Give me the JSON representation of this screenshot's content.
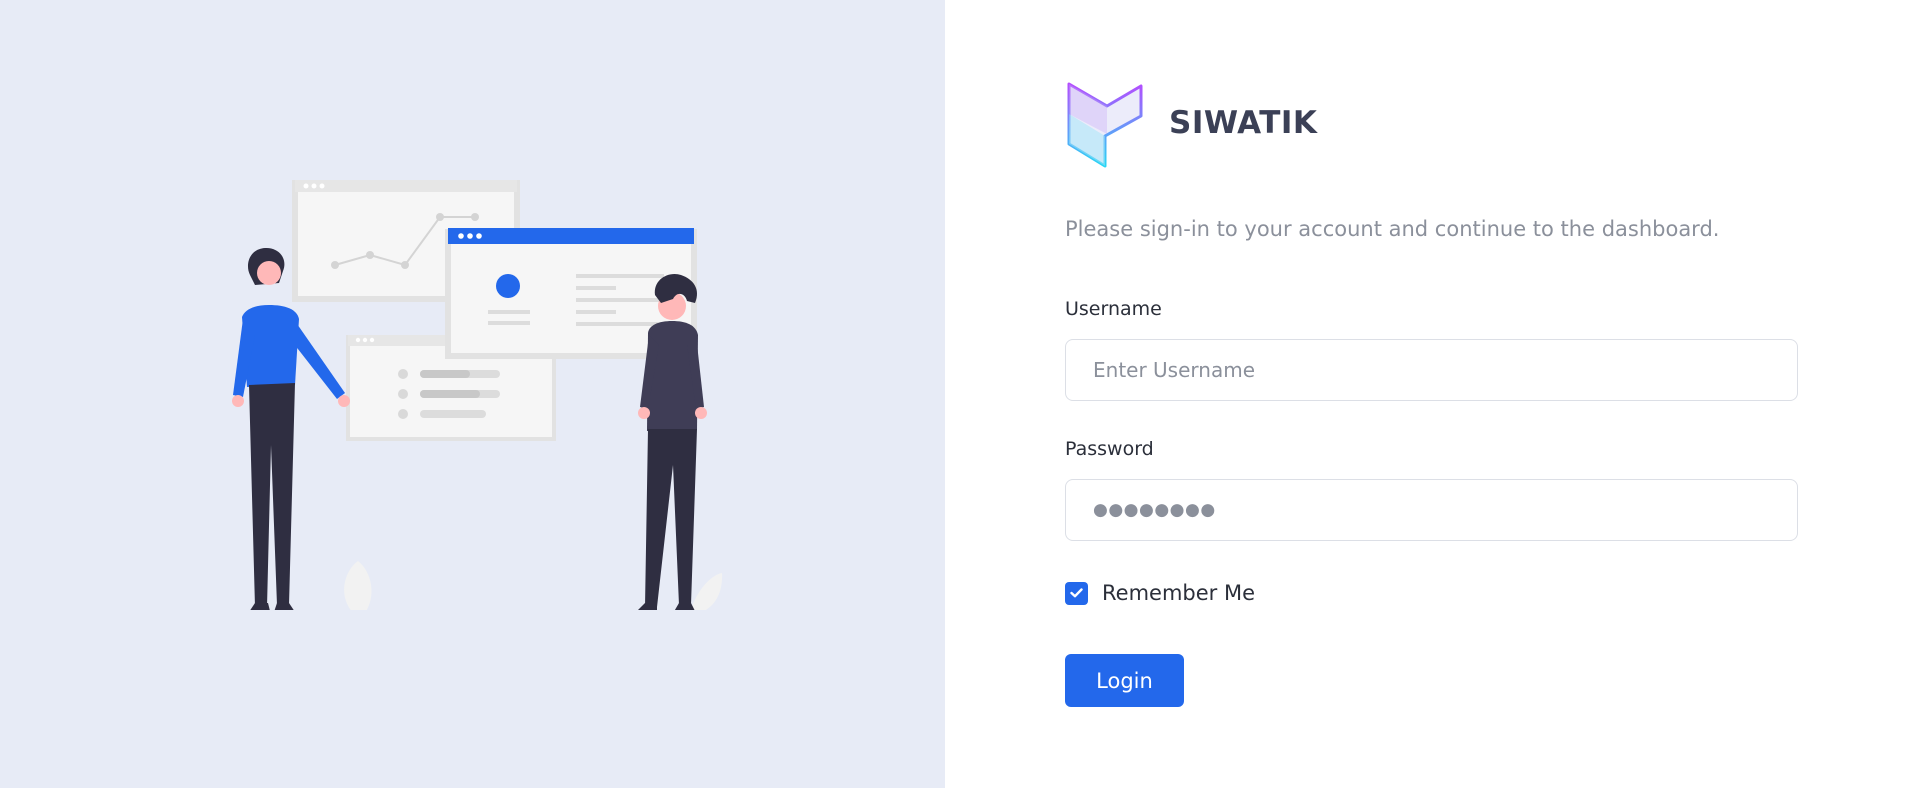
{
  "brand": {
    "name": "SIWATIK",
    "logo_icon": "siwatik-logo-icon"
  },
  "login": {
    "subtitle": "Please sign-in to your account and continue to the dashboard.",
    "username_label": "Username",
    "username_placeholder": "Enter Username",
    "username_value": "",
    "password_label": "Password",
    "password_value": "●●●●●●●●",
    "remember_label": "Remember Me",
    "remember_checked": true,
    "login_button": "Login"
  },
  "colors": {
    "left_panel_bg": "#e7ebf6",
    "accent": "#2368eb",
    "brand_text": "#3b4056",
    "muted_text": "#8b909b"
  },
  "illustration": {
    "icon": "team-dashboard-illustration"
  }
}
